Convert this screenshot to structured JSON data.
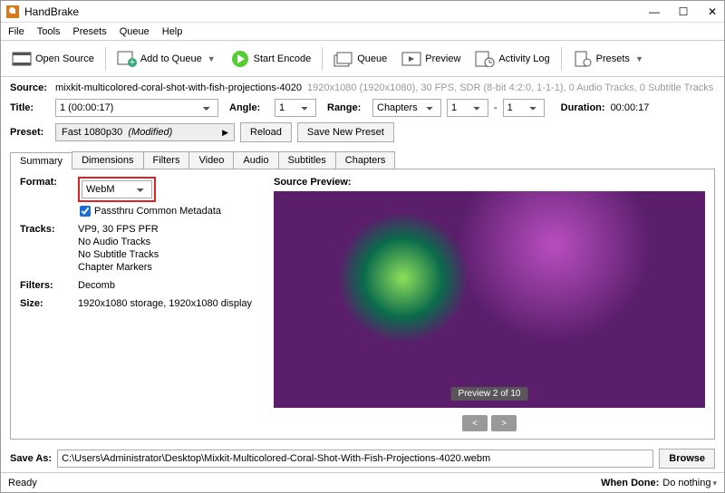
{
  "window": {
    "title": "HandBrake"
  },
  "winctrl": {
    "min": "—",
    "max": "☐",
    "close": "✕"
  },
  "menu": {
    "file": "File",
    "tools": "Tools",
    "presets": "Presets",
    "queue": "Queue",
    "help": "Help"
  },
  "toolbar": {
    "open_source": "Open Source",
    "add_to_queue": "Add to Queue",
    "start_encode": "Start Encode",
    "queue": "Queue",
    "preview": "Preview",
    "activity_log": "Activity Log",
    "presets": "Presets"
  },
  "source": {
    "label": "Source:",
    "file": "mixkit-multicolored-coral-shot-with-fish-projections-4020",
    "meta": "1920x1080 (1920x1080), 30 FPS, SDR (8-bit 4:2:0, 1-1-1), 0 Audio Tracks, 0 Subtitle Tracks"
  },
  "title": {
    "label": "Title:",
    "value": "1  (00:00:17)",
    "angle_label": "Angle:",
    "angle_value": "1",
    "range_label": "Range:",
    "range_type": "Chapters",
    "range_from": "1",
    "range_sep": "-",
    "range_to": "1",
    "duration_label": "Duration:",
    "duration_value": "00:00:17"
  },
  "preset": {
    "label": "Preset:",
    "value": "Fast 1080p30  (Modified)",
    "reload": "Reload",
    "save_new": "Save New Preset"
  },
  "tabs": {
    "summary": "Summary",
    "dimensions": "Dimensions",
    "filters": "Filters",
    "video": "Video",
    "audio": "Audio",
    "subtitles": "Subtitles",
    "chapters": "Chapters"
  },
  "summary": {
    "format_label": "Format:",
    "format_value": "WebM",
    "passthru_label": "Passthru Common Metadata",
    "tracks_label": "Tracks:",
    "tracks_v1": "VP9, 30 FPS PFR",
    "tracks_v2": "No Audio Tracks",
    "tracks_v3": "No Subtitle Tracks",
    "tracks_v4": "Chapter Markers",
    "filters_label": "Filters:",
    "filters_value": "Decomb",
    "size_label": "Size:",
    "size_value": "1920x1080 storage, 1920x1080 display",
    "preview_label": "Source Preview:",
    "preview_badge": "Preview 2 of 10",
    "nav_prev": "<",
    "nav_next": ">"
  },
  "saveas": {
    "label": "Save As:",
    "path": "C:\\Users\\Administrator\\Desktop\\Mixkit-Multicolored-Coral-Shot-With-Fish-Projections-4020.webm",
    "browse": "Browse"
  },
  "status": {
    "ready": "Ready",
    "when_done_label": "When Done:",
    "when_done_value": "Do nothing"
  }
}
